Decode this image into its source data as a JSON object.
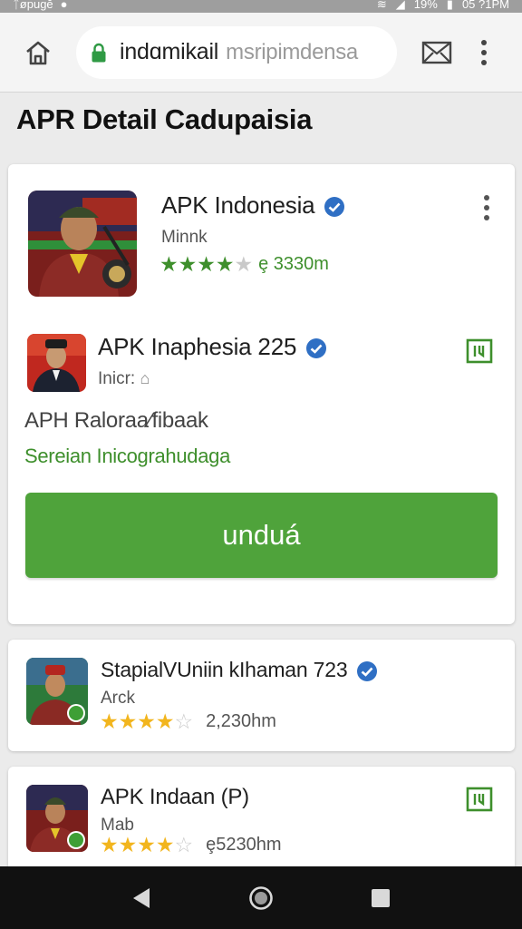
{
  "status_bar": {
    "left_text": "ᛏøpuɡĕ",
    "battery": "19%",
    "time": "05 ?1PM"
  },
  "browser": {
    "url_host": "indɑmikail",
    "url_path": "msripimdensa"
  },
  "page_title": "APR Detail Cadupaisia",
  "featured": {
    "name": "APK Indonesia",
    "developer": "Minnk",
    "rating": 4.5,
    "review_count": "ȩ 3330m"
  },
  "detail": {
    "name": "APK Inaphesia 225",
    "sub": "Inicr:",
    "description": "APH Raloraa⁄fibaak",
    "tagline": "Sereian Inicograhudaga",
    "install_label": "unduá"
  },
  "list": [
    {
      "name": "StapialVUniin kIhaman 723",
      "developer": "Arck",
      "rating": 4.0,
      "count": "2,230hm"
    },
    {
      "name": "APK Indaan (P)",
      "developer": "Mab",
      "rating": 3.5,
      "count": "ȩ5230hm"
    }
  ],
  "colors": {
    "accent_green": "#4fa33b",
    "star_green": "#3e8f2c",
    "star_yellow": "#f2b51d",
    "verified_blue": "#2f6fc4"
  },
  "icons": [
    "home-icon",
    "lock-icon",
    "tabs-icon",
    "overflow-menu-icon",
    "verified-icon",
    "bookmark-icon",
    "nav-back-icon",
    "nav-home-icon",
    "nav-recents-icon"
  ]
}
